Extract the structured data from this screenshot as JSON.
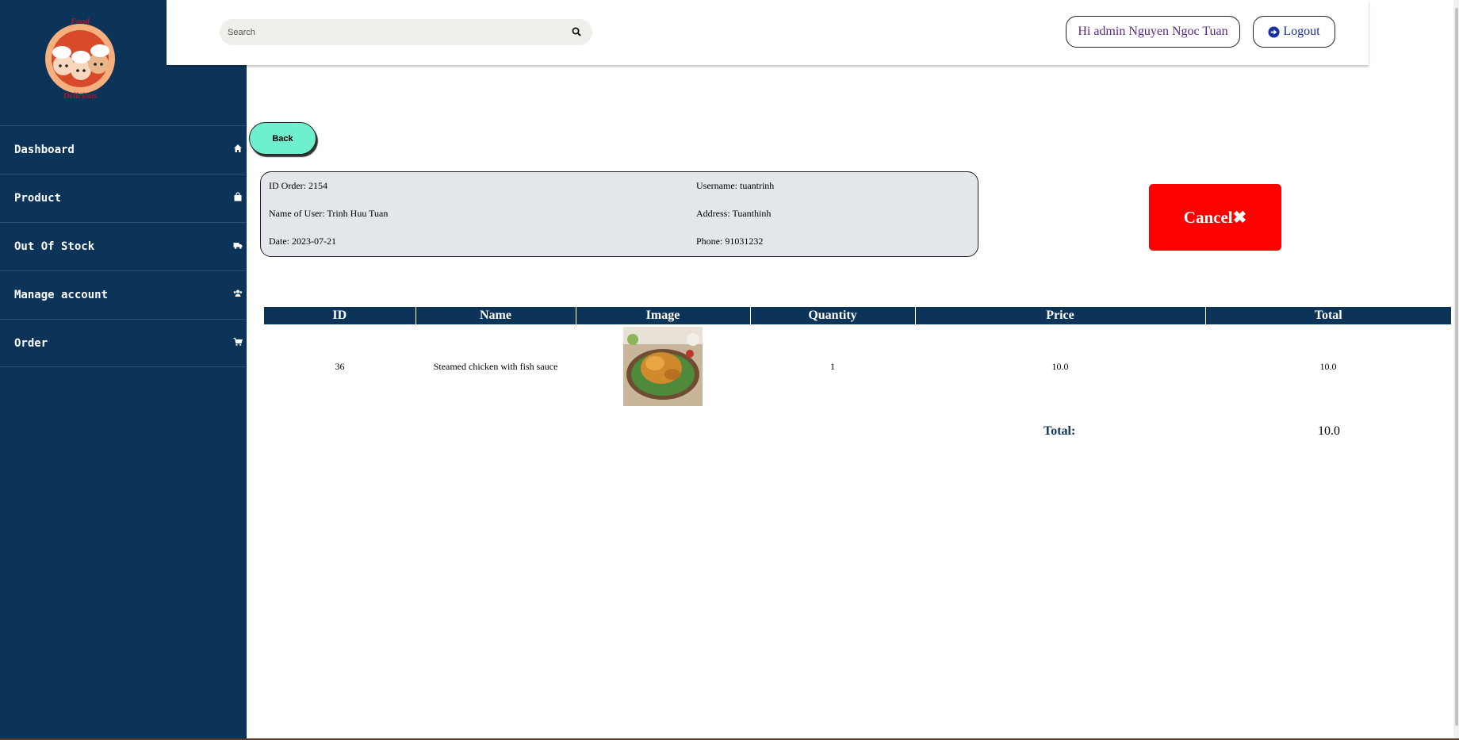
{
  "brand": {
    "logo_top": "Food",
    "logo_bottom": "Delicious"
  },
  "sidebar": {
    "items": [
      {
        "label": "Dashboard",
        "icon": "home-icon"
      },
      {
        "label": "Product",
        "icon": "shopping-bag-icon"
      },
      {
        "label": "Out Of Stock",
        "icon": "truck-icon"
      },
      {
        "label": "Manage account",
        "icon": "users-icon"
      },
      {
        "label": "Order",
        "icon": "cart-icon"
      }
    ]
  },
  "header": {
    "search_placeholder": "Search",
    "greeting": "Hi admin Nguyen Ngoc Tuan",
    "logout_label": "Logout"
  },
  "actions": {
    "back_label": "Back",
    "cancel_label": "Cancel✖"
  },
  "order": {
    "id": "ID Order: 2154",
    "username": "Username: tuantrinh",
    "name": "Name of User: Trinh Huu Tuan",
    "address": "Address: Tuanthinh",
    "date": "Date: 2023-07-21",
    "phone": "Phone: 91031232"
  },
  "table": {
    "headers": [
      "ID",
      "Name",
      "Image",
      "Quantity",
      "Price",
      "Total"
    ],
    "rows": [
      {
        "id": "36",
        "name": "Steamed chicken with fish sauce",
        "image": "steamed-chicken-photo",
        "quantity": "1",
        "price": "10.0",
        "total": "10.0"
      }
    ]
  },
  "summary": {
    "total_label": "Total:",
    "total_value": "10.0"
  },
  "colors": {
    "sidebar": "#0c3459",
    "back_button": "#6ef0cf",
    "cancel_button": "#fd0000",
    "info_box": "#e3e7ec"
  }
}
